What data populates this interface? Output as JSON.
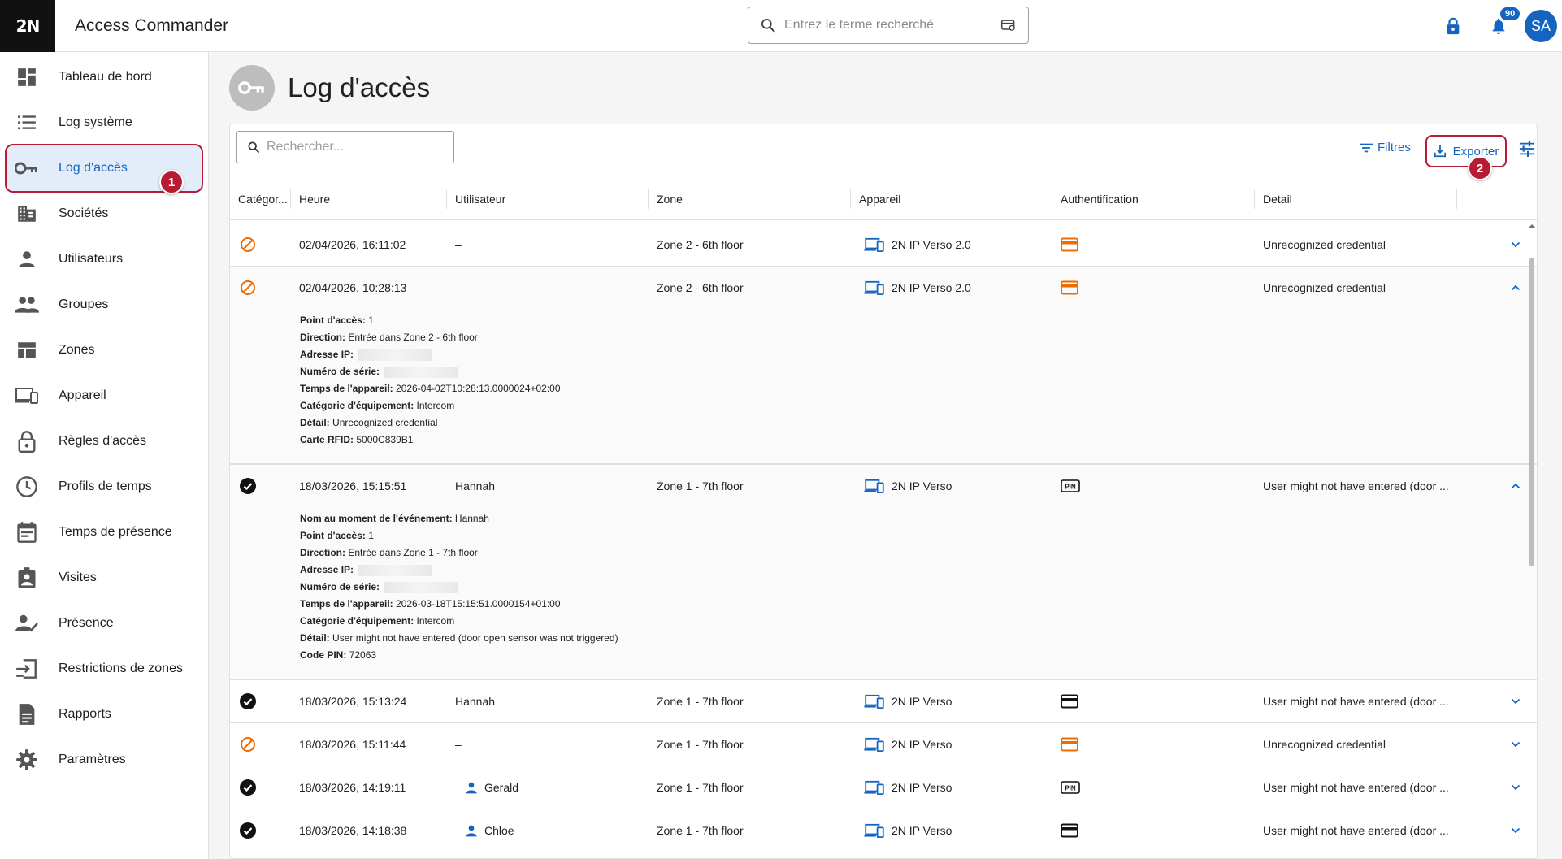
{
  "app": {
    "logo": "2N",
    "title": "Access Commander"
  },
  "topbar": {
    "search_placeholder": "Entrez le terme recherché",
    "notif_count": "90",
    "avatar_initials": "SA"
  },
  "sidebar": {
    "items": [
      {
        "label": "Tableau de bord",
        "icon": "dashboard-icon"
      },
      {
        "label": "Log système",
        "icon": "list-icon"
      },
      {
        "label": "Log d'accès",
        "icon": "key-icon"
      },
      {
        "label": "Sociétés",
        "icon": "building-icon"
      },
      {
        "label": "Utilisateurs",
        "icon": "person-icon"
      },
      {
        "label": "Groupes",
        "icon": "group-icon"
      },
      {
        "label": "Zones",
        "icon": "zones-icon"
      },
      {
        "label": "Appareil",
        "icon": "devices-icon"
      },
      {
        "label": "Règles d'accès",
        "icon": "lock-icon"
      },
      {
        "label": "Profils de temps",
        "icon": "clock-icon"
      },
      {
        "label": "Temps de présence",
        "icon": "calendar-icon"
      },
      {
        "label": "Visites",
        "icon": "visitor-icon"
      },
      {
        "label": "Présence",
        "icon": "person-check-icon"
      },
      {
        "label": "Restrictions de zones",
        "icon": "zone-restriction-icon"
      },
      {
        "label": "Rapports",
        "icon": "report-icon"
      },
      {
        "label": "Paramètres",
        "icon": "gear-icon"
      }
    ],
    "active_index": 2
  },
  "markers": {
    "m1": "1",
    "m2": "2"
  },
  "page": {
    "title": "Log d'accès"
  },
  "toolbar": {
    "search_placeholder": "Rechercher...",
    "filters": "Filtres",
    "export": "Exporter"
  },
  "table": {
    "columns": [
      "Catégor...",
      "Heure",
      "Utilisateur",
      "Zone",
      "Appareil",
      "Authentification",
      "Detail"
    ],
    "rows": [
      {
        "status": "denied",
        "time": "02/04/2026, 16:11:02",
        "user": "–",
        "user_icon": false,
        "zone": "Zone 2 - 6th floor",
        "device": "2N IP Verso 2.0",
        "auth": "card-orange",
        "detail": "Unrecognized credential",
        "expanded": false
      },
      {
        "status": "denied",
        "time": "02/04/2026, 10:28:13",
        "user": "–",
        "user_icon": false,
        "zone": "Zone 2 - 6th floor",
        "device": "2N IP Verso 2.0",
        "auth": "card-orange",
        "detail": "Unrecognized credential",
        "expanded": true,
        "details": [
          {
            "k": "Point d'accès:",
            "v": "1"
          },
          {
            "k": "Direction:",
            "v": "Entrée dans Zone 2 - 6th floor"
          },
          {
            "k": "Adresse IP:",
            "v": "",
            "redacted": true
          },
          {
            "k": "Numéro de série:",
            "v": "",
            "redacted": true
          },
          {
            "k": "Temps de l'appareil:",
            "v": "2026-04-02T10:28:13.0000024+02:00"
          },
          {
            "k": "Catégorie d'équipement:",
            "v": "Intercom"
          },
          {
            "k": "Détail:",
            "v": "Unrecognized credential"
          },
          {
            "k": "Carte RFID:",
            "v": " 5000C839B1"
          }
        ]
      },
      {
        "status": "granted",
        "time": "18/03/2026, 15:15:51",
        "user": "Hannah",
        "user_icon": false,
        "zone": "Zone 1 - 7th floor",
        "device": "2N IP Verso",
        "auth": "pin",
        "detail": "User might not have entered (door ...",
        "expanded": true,
        "details": [
          {
            "k": "Nom au moment de l'événement:",
            "v": "Hannah"
          },
          {
            "k": "Point d'accès:",
            "v": "1"
          },
          {
            "k": "Direction:",
            "v": "Entrée dans Zone 1 - 7th floor"
          },
          {
            "k": "Adresse IP:",
            "v": "",
            "redacted": true
          },
          {
            "k": "Numéro de série:",
            "v": "",
            "redacted": true
          },
          {
            "k": "Temps de l'appareil:",
            "v": "2026-03-18T15:15:51.0000154+01:00"
          },
          {
            "k": "Catégorie d'équipement:",
            "v": "Intercom"
          },
          {
            "k": "Détail:",
            "v": "User might not have entered (door open sensor was not triggered)"
          },
          {
            "k": "Code PIN:",
            "v": " 72063"
          }
        ]
      },
      {
        "status": "granted",
        "time": "18/03/2026, 15:13:24",
        "user": "Hannah",
        "user_icon": false,
        "zone": "Zone 1 - 7th floor",
        "device": "2N IP Verso",
        "auth": "card-black",
        "detail": "User might not have entered (door ...",
        "expanded": false
      },
      {
        "status": "denied",
        "time": "18/03/2026, 15:11:44",
        "user": "–",
        "user_icon": false,
        "zone": "Zone 1 - 7th floor",
        "device": "2N IP Verso",
        "auth": "card-orange",
        "detail": "Unrecognized credential",
        "expanded": false
      },
      {
        "status": "granted",
        "time": "18/03/2026, 14:19:11",
        "user": "Gerald",
        "user_icon": true,
        "zone": "Zone 1 - 7th floor",
        "device": "2N IP Verso",
        "auth": "pin",
        "detail": "User might not have entered (door ...",
        "expanded": false
      },
      {
        "status": "granted",
        "time": "18/03/2026, 14:18:38",
        "user": "Chloe",
        "user_icon": true,
        "zone": "Zone 1 - 7th floor",
        "device": "2N IP Verso",
        "auth": "card-black",
        "detail": "User might not have entered (door ...",
        "expanded": false
      }
    ]
  },
  "colors": {
    "accent": "#1565c0",
    "denied": "#ef6c00",
    "marker": "#b71c32",
    "active_bg": "#e3ecf9"
  }
}
